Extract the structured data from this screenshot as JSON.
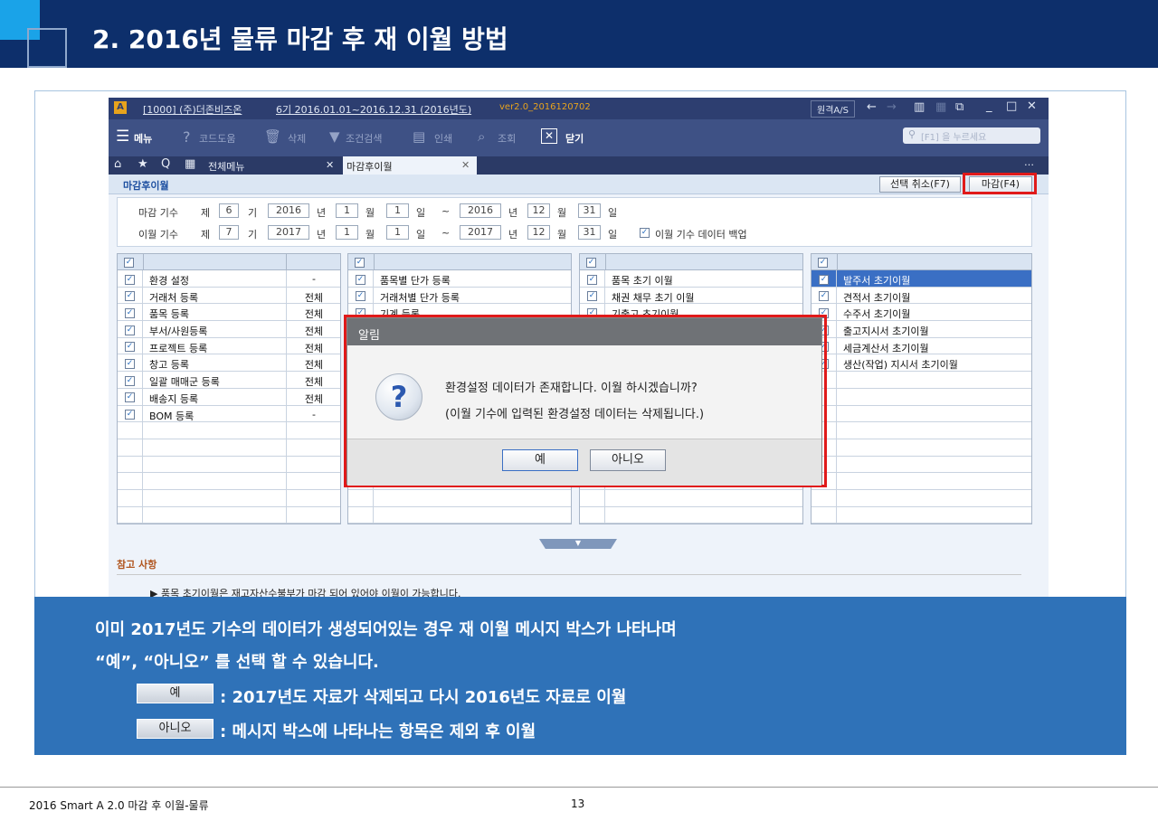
{
  "slide": {
    "title": "2. 2016년 물류 마감 후 재 이월 방법"
  },
  "app": {
    "titlebar": {
      "company": "[1000] (주)더존비즈온",
      "period": "6기 2016.01.01~2016.12.31 (2016년도)",
      "version": "ver2.0_2016120702",
      "remote": "원격A/S"
    },
    "toolbar": {
      "menu": "메뉴",
      "codehelp": "코드도움",
      "delete": "삭제",
      "filter": "조건검색",
      "print": "인쇄",
      "search": "조회",
      "close": "닫기",
      "search_placeholder": "[F1] 을 누르세요"
    },
    "tabs": {
      "all_menu": "전체메뉴",
      "current": "마감후이월"
    },
    "sub": {
      "title": "마감후이월",
      "cancel_btn": "선택 취소(F7)",
      "close_btn": "마감(F4)"
    },
    "form": {
      "row1": {
        "label": "마감 기수",
        "je": "제",
        "gi_val": "6",
        "gi": "기",
        "y1": "2016",
        "nyeon": "년",
        "m1": "1",
        "wol": "월",
        "d1": "1",
        "il": "일",
        "tilde": "~",
        "y2": "2016",
        "m2": "12",
        "d2": "31"
      },
      "row2": {
        "label": "이월 기수",
        "je": "제",
        "gi_val": "7",
        "gi": "기",
        "y1": "2017",
        "nyeon": "년",
        "m1": "1",
        "wol": "월",
        "d1": "1",
        "il": "일",
        "tilde": "~",
        "y2": "2017",
        "m2": "12",
        "d2": "31",
        "backup": "이월 기수 데이터 백업"
      }
    },
    "grid1": [
      {
        "t": "환경 설정",
        "v": "-"
      },
      {
        "t": "거래처 등록",
        "v": "전체"
      },
      {
        "t": "품목 등록",
        "v": "전체"
      },
      {
        "t": "부서/사원등록",
        "v": "전체"
      },
      {
        "t": "프로젝트 등록",
        "v": "전체"
      },
      {
        "t": "창고 등록",
        "v": "전체"
      },
      {
        "t": "일괄 매매군 등록",
        "v": "전체"
      },
      {
        "t": "배송지 등록",
        "v": "전체"
      },
      {
        "t": "BOM 등록",
        "v": "-"
      }
    ],
    "grid2": [
      {
        "t": "품목별 단가 등록"
      },
      {
        "t": "거래처별 단가 등록"
      },
      {
        "t": "기계 등록"
      }
    ],
    "grid3": [
      {
        "t": "품목 초기 이월"
      },
      {
        "t": "채권 채무 초기 이월"
      },
      {
        "t": "기출고 초기이월"
      }
    ],
    "grid4": [
      {
        "t": "발주서 초기이월"
      },
      {
        "t": "견적서 초기이월"
      },
      {
        "t": "수주서 초기이월"
      },
      {
        "t": "출고지시서 초기이월"
      },
      {
        "t": "세금계산서 초기이월"
      },
      {
        "t": "생산(작업) 지시서 초기이월"
      }
    ],
    "check_mark": "✓",
    "ref": {
      "title": "참고 사항",
      "text": "▶ 품목 초기이월은 재고자산수불부가 마감 되어 있어야 이월이 가능합니다."
    },
    "dialog": {
      "title": "알림",
      "line1": "환경설정 데이터가 존재합니다. 이월 하시겠습니까?",
      "line2": "(이월 기수에 입력된 환경설정 데이터는 삭제됩니다.)",
      "yes": "예",
      "no": "아니오",
      "icon": "?"
    }
  },
  "banner": {
    "line1": "이미 2017년도 기수의 데이터가 생성되어있는 경우 재 이월 메시지 박스가 나타나며",
    "line2": "“예”, “아니오” 를 선택 할 수 있습니다.",
    "yes_btn": "예",
    "yes_text": ": 2017년도 자료가 삭제되고 다시 2016년도 자료로 이월",
    "no_btn": "아니오",
    "no_text": ": 메시지 박스에 나타나는 항목은 제외 후 이월"
  },
  "footer": {
    "left": "2016 Smart A 2.0 마감 후 이월-물류",
    "page": "13"
  }
}
